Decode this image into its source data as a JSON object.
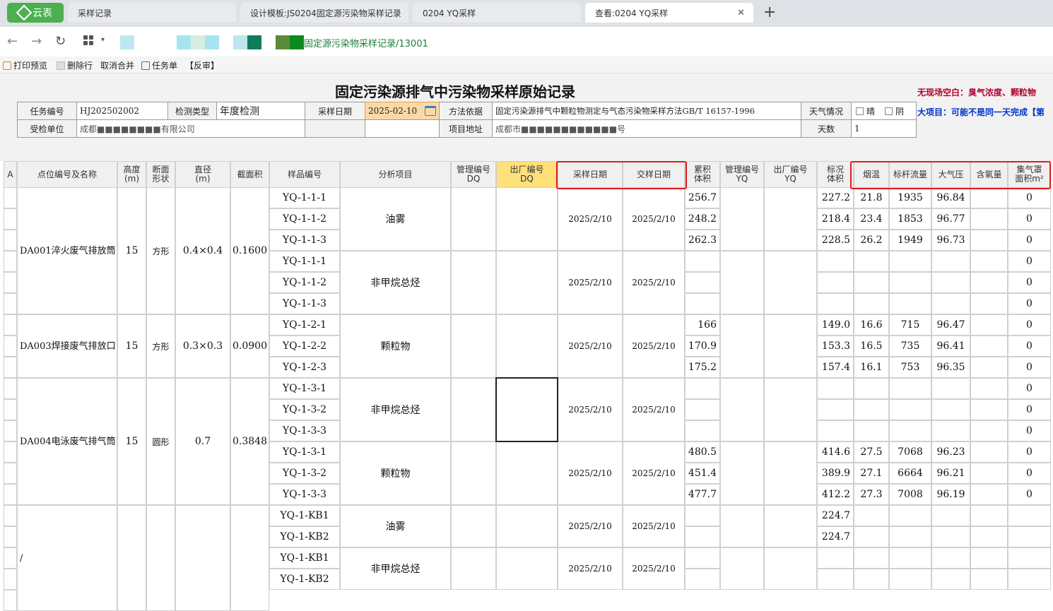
{
  "browser": {
    "logo_label": "云表",
    "tabs": [
      {
        "label": "采样记录"
      },
      {
        "label": "设计模板:JS0204固定源污染物采样记录"
      },
      {
        "label": "0204 YQ采样"
      },
      {
        "label": "查看:0204 YQ采样"
      }
    ],
    "url": "固定源污染物采样记录/13001",
    "colors": {
      "logo": "#4caf50",
      "url_text": "#1a7f37"
    }
  },
  "toolbar": {
    "print_preview": "打印预览",
    "delete_row": "删除行",
    "unmerge": "取消合并",
    "task": "任务单",
    "reverse_audit": "【反审】"
  },
  "form": {
    "title": "固定污染源排气中污染物采样原始记录",
    "note_red": "无现场空白：臭气浓度、颗粒物",
    "note_blue": "大项目：可能不是同一天完成【第",
    "task_no_label": "任务编号",
    "task_no": "HJ202502002",
    "detect_type_label": "检测类型",
    "detect_type": "年度检测",
    "sample_date_label": "采样日期",
    "sample_date": "2025-02-10",
    "method_label": "方法依据",
    "method": "固定污染源排气中颗粒物测定与气态污染物采样方法GB/T 16157-1996",
    "weather_label": "天气情况",
    "sunny": "晴",
    "cloudy": "阴",
    "unit_label": "受检单位",
    "unit": "成都■■■■■■■■有限公司",
    "address_label": "项目地址",
    "address": "成都市■■■■■■■■■■■■号",
    "days_label": "天数",
    "days": "1"
  },
  "headers": {
    "rownum": "A",
    "point": "点位编号及名称",
    "height": "高度\n(m)",
    "shape": "断面\n形状",
    "diameter": "直径\n(m)",
    "area": "截面积",
    "sample_no": "样品编号",
    "analysis": "分析项目",
    "mgmt_dq": "管理编号\nDQ",
    "out_dq": "出厂编号\nDQ",
    "sample_date": "采样日期",
    "submit_date": "交样日期",
    "cum_vol": "累积\n体积",
    "mgmt_yq": "管理编号\nYQ",
    "out_yq": "出厂编号\nYQ",
    "std_vol": "标况\n体积",
    "smoke_temp": "烟温",
    "pitot_flow": "标杆流量",
    "atm": "大气压",
    "oxygen": "含氧量",
    "hood_area": "集气罩\n面积m²"
  },
  "points": [
    {
      "name": "DA001淬火废气排放筒",
      "height": "15",
      "shape": "方形",
      "diameter": "0.4×0.4",
      "area": "0.1600"
    },
    {
      "name": "DA003焊接废气排放口",
      "height": "15",
      "shape": "方形",
      "diameter": "0.3×0.3",
      "area": "0.0900"
    },
    {
      "name": "DA004电泳废气排气筒",
      "height": "15",
      "shape": "圆形",
      "diameter": "0.7",
      "area": "0.3848"
    },
    {
      "name": "/",
      "height": "",
      "shape": "",
      "diameter": "",
      "area": ""
    }
  ],
  "groups": [
    {
      "analysis": "油雾",
      "sample_date": "2025/2/10",
      "submit_date": "2025/2/10"
    },
    {
      "analysis": "非甲烷总烃",
      "sample_date": "2025/2/10",
      "submit_date": "2025/2/10"
    },
    {
      "analysis": "颗粒物",
      "sample_date": "2025/2/10",
      "submit_date": "2025/2/10"
    },
    {
      "analysis": "非甲烷总烃",
      "sample_date": "2025/2/10",
      "submit_date": "2025/2/10"
    },
    {
      "analysis": "颗粒物",
      "sample_date": "2025/2/10",
      "submit_date": "2025/2/10"
    },
    {
      "analysis": "油雾",
      "sample_date": "2025/2/10",
      "submit_date": "2025/2/10"
    },
    {
      "analysis": "非甲烷总烃",
      "sample_date": "2025/2/10",
      "submit_date": "2025/2/10"
    }
  ],
  "rows": [
    {
      "sample": "YQ-1-1-1",
      "cum": "256.7",
      "std": "227.2",
      "temp": "21.8",
      "flow": "1935",
      "atm": "96.84",
      "hood": "0"
    },
    {
      "sample": "YQ-1-1-2",
      "cum": "248.2",
      "std": "218.4",
      "temp": "23.4",
      "flow": "1853",
      "atm": "96.77",
      "hood": "0"
    },
    {
      "sample": "YQ-1-1-3",
      "cum": "262.3",
      "std": "228.5",
      "temp": "26.2",
      "flow": "1949",
      "atm": "96.73",
      "hood": "0"
    },
    {
      "sample": "YQ-1-1-1",
      "cum": "",
      "std": "",
      "temp": "",
      "flow": "",
      "atm": "",
      "hood": "0"
    },
    {
      "sample": "YQ-1-1-2",
      "cum": "",
      "std": "",
      "temp": "",
      "flow": "",
      "atm": "",
      "hood": "0"
    },
    {
      "sample": "YQ-1-1-3",
      "cum": "",
      "std": "",
      "temp": "",
      "flow": "",
      "atm": "",
      "hood": "0"
    },
    {
      "sample": "YQ-1-2-1",
      "cum": "166",
      "std": "149.0",
      "temp": "16.6",
      "flow": "715",
      "atm": "96.47",
      "hood": "0"
    },
    {
      "sample": "YQ-1-2-2",
      "cum": "170.9",
      "std": "153.3",
      "temp": "16.5",
      "flow": "735",
      "atm": "96.41",
      "hood": "0"
    },
    {
      "sample": "YQ-1-2-3",
      "cum": "175.2",
      "std": "157.4",
      "temp": "16.1",
      "flow": "753",
      "atm": "96.35",
      "hood": "0"
    },
    {
      "sample": "YQ-1-3-1",
      "cum": "",
      "std": "",
      "temp": "",
      "flow": "",
      "atm": "",
      "hood": "0"
    },
    {
      "sample": "YQ-1-3-2",
      "cum": "",
      "std": "",
      "temp": "",
      "flow": "",
      "atm": "",
      "hood": "0"
    },
    {
      "sample": "YQ-1-3-3",
      "cum": "",
      "std": "",
      "temp": "",
      "flow": "",
      "atm": "",
      "hood": "0"
    },
    {
      "sample": "YQ-1-3-1",
      "cum": "480.5",
      "std": "414.6",
      "temp": "27.5",
      "flow": "7068",
      "atm": "96.23",
      "hood": "0"
    },
    {
      "sample": "YQ-1-3-2",
      "cum": "451.4",
      "std": "389.9",
      "temp": "27.1",
      "flow": "6664",
      "atm": "96.21",
      "hood": "0"
    },
    {
      "sample": "YQ-1-3-3",
      "cum": "477.7",
      "std": "412.2",
      "temp": "27.3",
      "flow": "7008",
      "atm": "96.19",
      "hood": "0"
    },
    {
      "sample": "YQ-1-KB1",
      "cum": "",
      "std": "224.7",
      "temp": "",
      "flow": "",
      "atm": "",
      "hood": ""
    },
    {
      "sample": "YQ-1-KB2",
      "cum": "",
      "std": "224.7",
      "temp": "",
      "flow": "",
      "atm": "",
      "hood": ""
    },
    {
      "sample": "YQ-1-KB1",
      "cum": "",
      "std": "",
      "temp": "",
      "flow": "",
      "atm": "",
      "hood": ""
    },
    {
      "sample": "YQ-1-KB2",
      "cum": "",
      "std": "",
      "temp": "",
      "flow": "",
      "atm": "",
      "hood": ""
    }
  ]
}
